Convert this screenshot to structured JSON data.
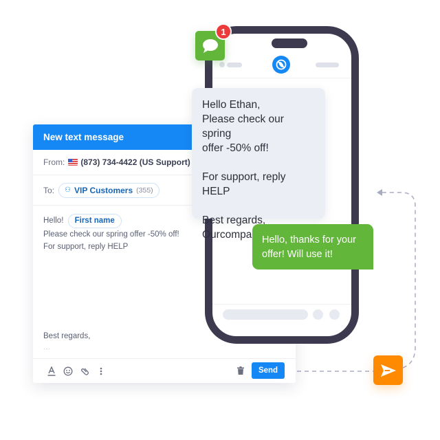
{
  "composer": {
    "title": "New text message",
    "from_label": "From:",
    "from_number": "(873) 734-4422 (US Support)",
    "from_flag": "us-flag",
    "to_label": "To:",
    "to_group_name": "VIP Customers",
    "to_group_count": "(355)",
    "body_greeting": "Hello!",
    "body_placeholder_chip": "First name",
    "body_line2": "Please check our spring offer -50% off!",
    "body_line3": "For support, reply HELP",
    "signoff": "Best regards,",
    "signoff_more": "...",
    "toolbar": {
      "icons": [
        "text-format-icon",
        "emoji-icon",
        "attachment-icon",
        "more-vertical-icon"
      ],
      "delete_icon": "trash-icon",
      "send_label": "Send"
    }
  },
  "phone": {
    "notification_badge": "1",
    "incoming_message": {
      "lines": [
        "Hello Ethan,",
        "Please check our spring",
        "offer -50% off!",
        "",
        "For support, reply HELP",
        "",
        "Best regards,",
        "Ourcompany LLC"
      ]
    },
    "reply_message": "Hello, thanks for your offer! Will use it!"
  },
  "colors": {
    "brand_blue": "#1688f5",
    "sms_green": "#62b63a",
    "send_orange": "#ff8a00",
    "badge_red": "#ec3b3b",
    "phone_frame": "#3d3a4f"
  }
}
